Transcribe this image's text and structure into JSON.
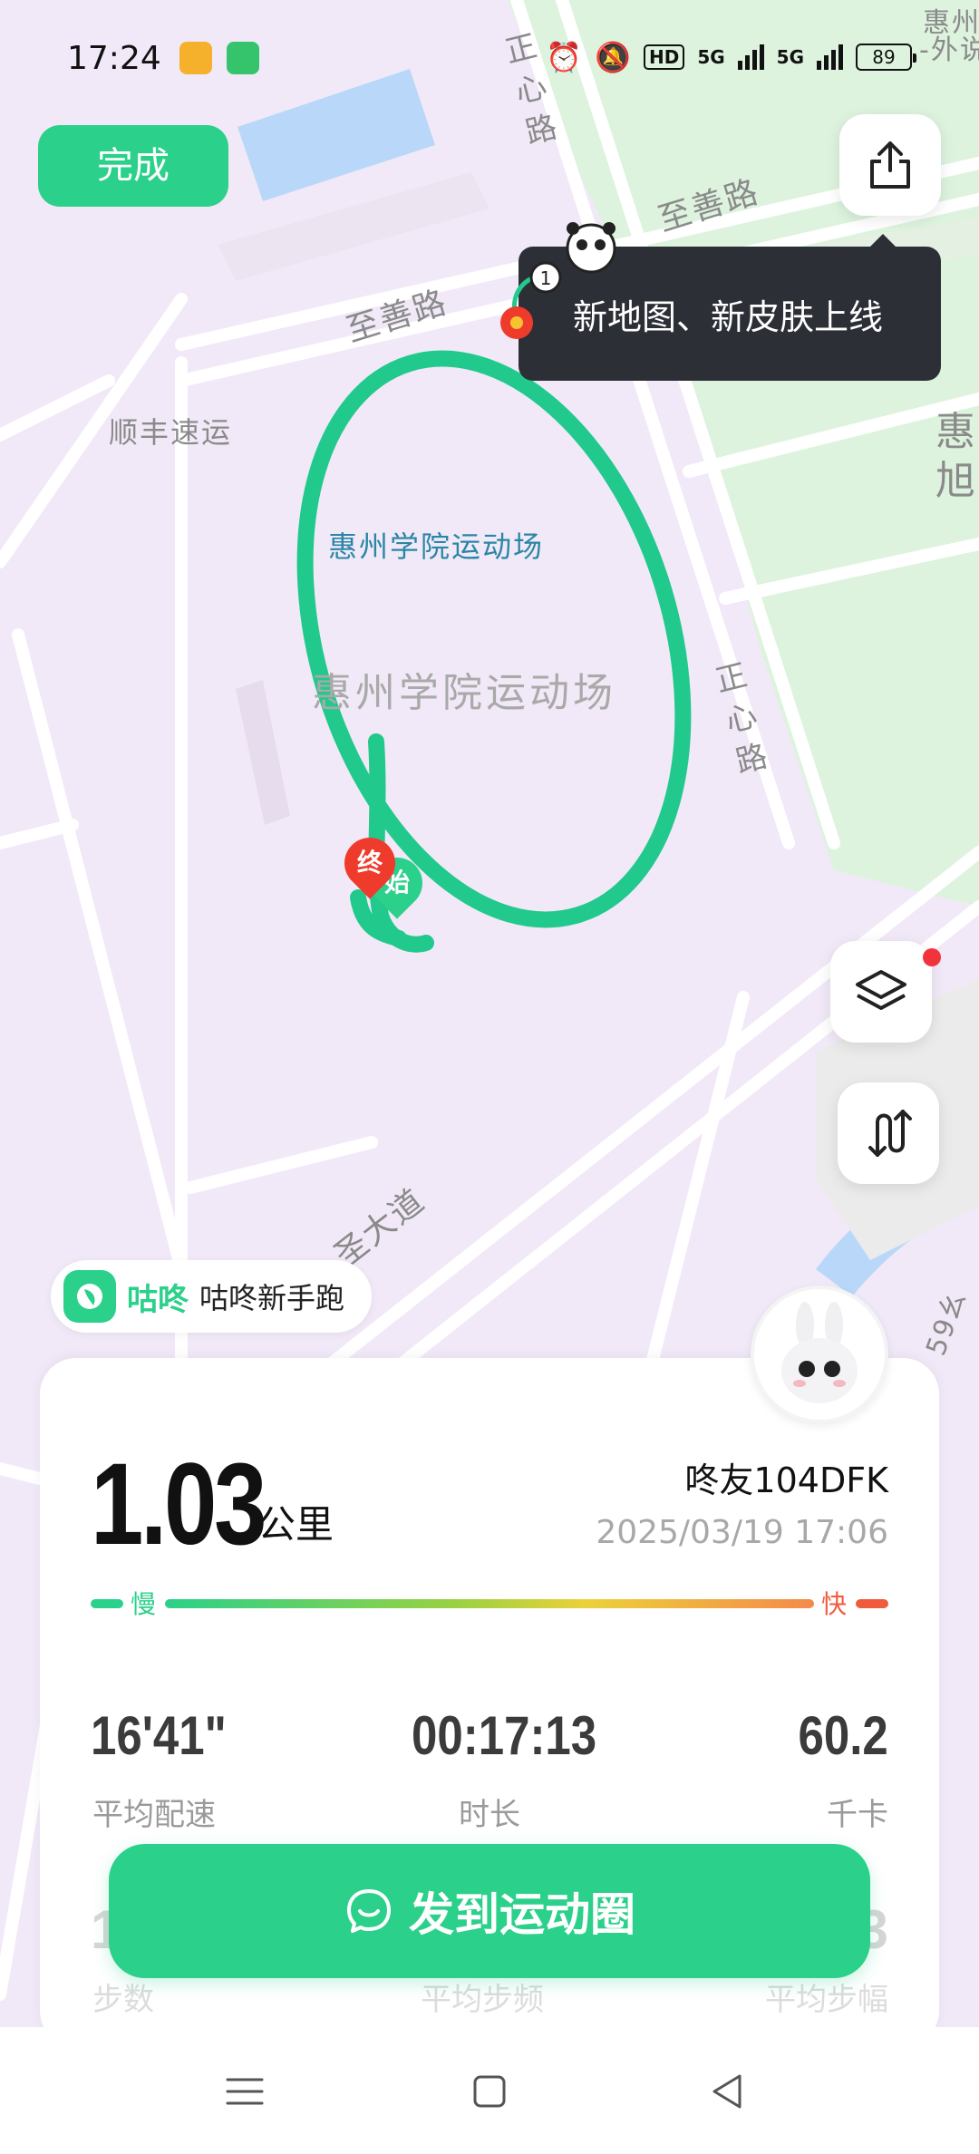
{
  "status_bar": {
    "time": "17:24",
    "signal1": "5G",
    "signal2": "5G",
    "hd": "HD",
    "battery": "89"
  },
  "map": {
    "labels": {
      "road_zhishan_1": "至善路",
      "road_zhishan_2": "至善路",
      "road_zhengxin_top": "正心路",
      "road_zhengxin_mid": "正心路",
      "shunfeng": "顺丰速运",
      "stadium_blue": "惠州学院运动场",
      "stadium_gray": "惠州学院运动场",
      "avenue": "圣大道",
      "corner_top": "惠州",
      "corner_top2": "-外说",
      "corner_right": "惠",
      "corner_right2": "旭",
      "corner_bottom": "59幺"
    },
    "pin_end": "终",
    "pin_start": "始"
  },
  "toolbar": {
    "done_label": "完成",
    "tooltip_text": "新地图、新皮肤上线"
  },
  "icons": {
    "share": "share-icon",
    "layers": "layers-icon",
    "route": "route-icon"
  },
  "tag": {
    "brand": "咕咚",
    "text": "咕咚新手跑"
  },
  "summary": {
    "distance": "1.03",
    "unit": "公里",
    "user": "咚友104DFK",
    "datetime": "2025/03/19 17:06",
    "pace_slow": "慢",
    "pace_fast": "快",
    "stats": [
      {
        "value": "16'41\"",
        "label": "平均配速"
      },
      {
        "value": "00:17:13",
        "label": "时长"
      },
      {
        "value": "60.2",
        "label": "千卡"
      }
    ],
    "stats_row2": [
      {
        "value": "1",
        "label": "步数"
      },
      {
        "value": "3",
        "label": "平均步幅"
      },
      {
        "value": "",
        "label": "平均步频"
      }
    ]
  },
  "share_button": {
    "label": "发到运动圈"
  },
  "colors": {
    "accent": "#2bd08a",
    "route": "#22c98c",
    "pin_end": "#ef3b2c",
    "tooltip_bg": "#2d2f36",
    "map_bg": "#f1e9f7"
  }
}
